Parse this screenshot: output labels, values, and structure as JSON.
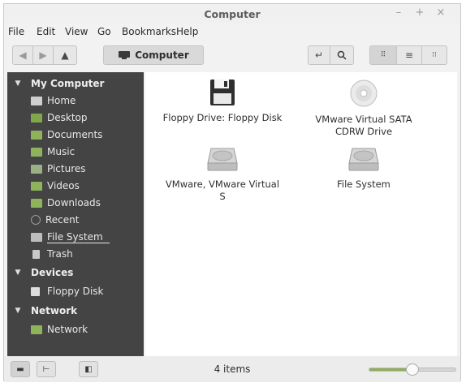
{
  "window": {
    "title": "Computer",
    "controls": [
      "minimize-icon",
      "maximize-icon",
      "close-icon"
    ]
  },
  "menubar": [
    "File",
    "Edit",
    "View",
    "Go",
    "Bookmarks",
    "Help"
  ],
  "toolbar": {
    "location": "Computer"
  },
  "sidebar": {
    "sections": [
      {
        "title": "My Computer",
        "items": [
          {
            "label": "Home",
            "icon": "home-folder-icon"
          },
          {
            "label": "Desktop",
            "icon": "desktop-folder-icon"
          },
          {
            "label": "Documents",
            "icon": "documents-folder-icon"
          },
          {
            "label": "Music",
            "icon": "music-folder-icon"
          },
          {
            "label": "Pictures",
            "icon": "pictures-folder-icon"
          },
          {
            "label": "Videos",
            "icon": "videos-folder-icon"
          },
          {
            "label": "Downloads",
            "icon": "downloads-folder-icon"
          },
          {
            "label": "Recent",
            "icon": "recent-icon"
          },
          {
            "label": "File System",
            "icon": "drive-icon"
          },
          {
            "label": "Trash",
            "icon": "trash-icon"
          }
        ]
      },
      {
        "title": "Devices",
        "items": [
          {
            "label": "Floppy Disk",
            "icon": "floppy-icon"
          }
        ]
      },
      {
        "title": "Network",
        "items": [
          {
            "label": "Network",
            "icon": "network-icon"
          }
        ]
      }
    ]
  },
  "items": [
    {
      "label": "Floppy Drive: Floppy Disk",
      "icon": "floppy-drive-icon"
    },
    {
      "label": "VMware Virtual SATA CDRW Drive",
      "icon": "optical-drive-icon"
    },
    {
      "label": "VMware, VMware Virtual S",
      "icon": "hard-drive-icon"
    },
    {
      "label": "File System",
      "icon": "hard-drive-icon"
    }
  ],
  "status": {
    "text": "4 items",
    "zoom_fraction": 0.5
  },
  "colors": {
    "sidebar_bg": "#444444",
    "accent": "#8fae5a"
  }
}
